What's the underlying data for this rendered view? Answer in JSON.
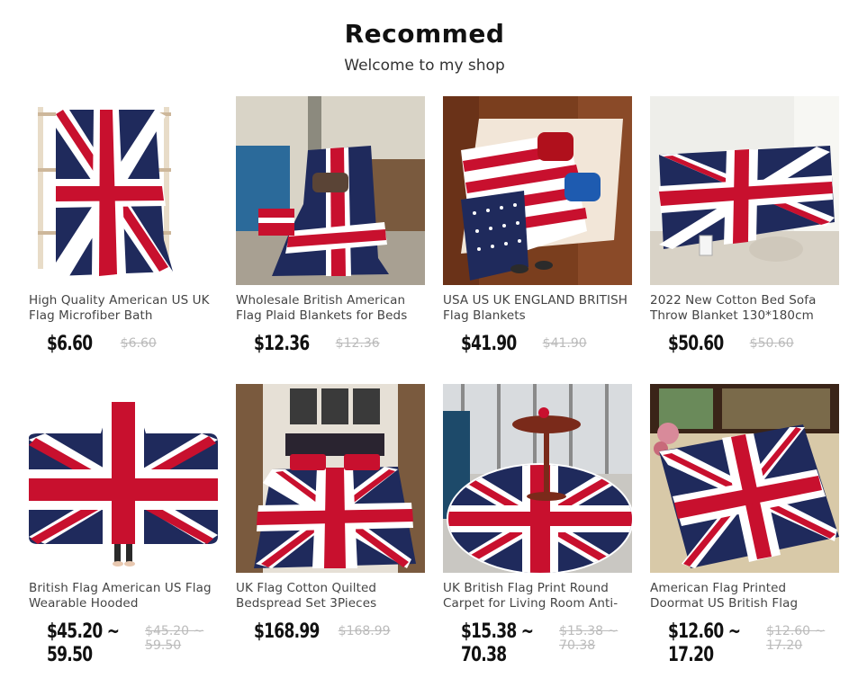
{
  "header": {
    "title": "Recommed",
    "subtitle": "Welcome to my shop"
  },
  "products": [
    {
      "name": "High Quality American US UK Flag Microfiber Bath",
      "price": "$6.60",
      "original_price": "$6.60",
      "image": "union-jack-blanket-on-rack"
    },
    {
      "name": "Wholesale British American Flag Plaid Blankets for Beds",
      "price": "$12.36",
      "original_price": "$12.36",
      "image": "union-jack-blanket-on-chair"
    },
    {
      "name": "USA US UK ENGLAND BRITISH Flag Blankets",
      "price": "$41.90",
      "original_price": "$41.90",
      "image": "us-flag-blanket-on-bed"
    },
    {
      "name": "2022 New Cotton Bed Sofa Throw Blanket 130*180cm",
      "price": "$50.60",
      "original_price": "$50.60",
      "image": "union-jack-sofa-throw"
    },
    {
      "name": "British Flag American US Flag Wearable Hooded",
      "price": "$45.20 ~ 59.50",
      "original_price": "$45.20 ~ 59.50",
      "image": "union-jack-hooded-blanket"
    },
    {
      "name": "UK Flag Cotton Quilted Bedspread Set 3Pieces",
      "price": "$168.99",
      "original_price": "$168.99",
      "image": "union-jack-bedspread"
    },
    {
      "name": "UK British Flag Print Round Carpet for Living Room Anti-",
      "price": "$15.38 ~ 70.38",
      "original_price": "$15.38 ~ 70.38",
      "image": "union-jack-round-carpet"
    },
    {
      "name": "American Flag Printed Doormat US British Flag",
      "price": "$12.60 ~ 17.20",
      "original_price": "$12.60 ~ 17.20",
      "image": "union-jack-doormat"
    }
  ],
  "colors": {
    "flag_blue": "#1f2a5c",
    "flag_red": "#c8102e",
    "flag_white": "#ffffff",
    "strike_price": "#bbbbbb"
  }
}
